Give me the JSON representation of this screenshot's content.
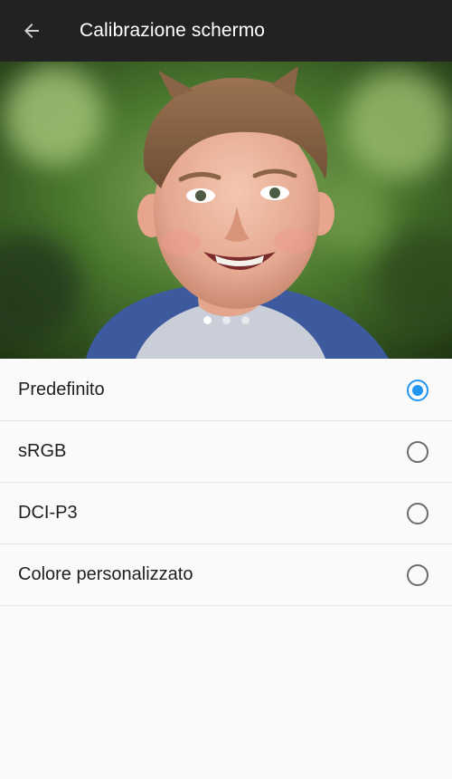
{
  "header": {
    "back_icon": "arrow-left-icon",
    "title": "Calibrazione schermo"
  },
  "preview": {
    "image": "smiling-child-photo",
    "pager": {
      "count": 3,
      "active_index": 0
    }
  },
  "options": [
    {
      "label": "Predefinito",
      "selected": true
    },
    {
      "label": "sRGB",
      "selected": false
    },
    {
      "label": "DCI-P3",
      "selected": false
    },
    {
      "label": "Colore personalizzato",
      "selected": false
    }
  ],
  "colors": {
    "app_bar": "#222222",
    "accent": "#2196f3",
    "background": "#fafafa"
  }
}
